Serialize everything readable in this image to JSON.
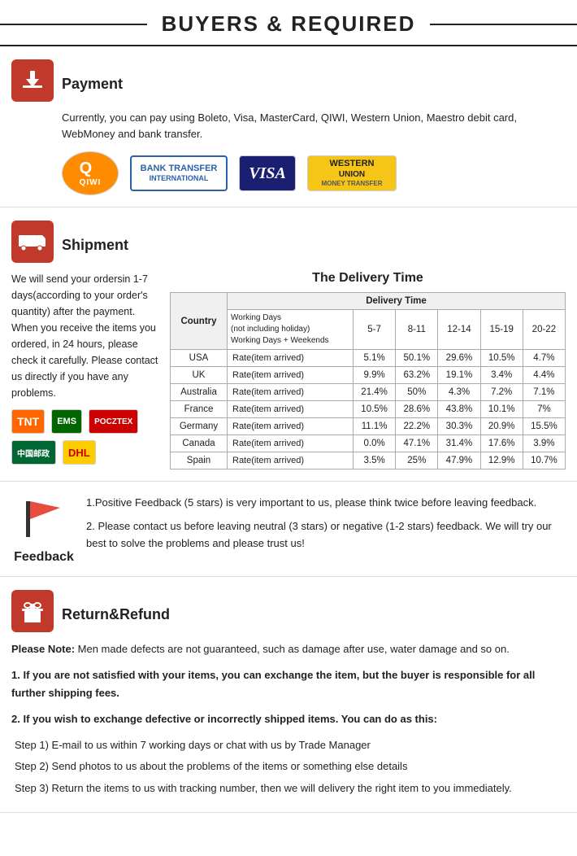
{
  "header": {
    "title": "BUYERS & REQUIRED"
  },
  "payment": {
    "section_title": "Payment",
    "description": "Currently, you can pay using Boleto, Visa, MasterCard, QIWI, Western Union, Maestro  debit card, WebMoney and bank transfer.",
    "logos": [
      {
        "name": "QIWI",
        "type": "qiwi"
      },
      {
        "name": "BANK TRANSFER INTERNATIONAL",
        "type": "bank"
      },
      {
        "name": "VISA",
        "type": "visa"
      },
      {
        "name": "WESTERN UNION MONEY TRANSFER",
        "type": "wu"
      }
    ]
  },
  "shipment": {
    "section_title": "Shipment",
    "delivery_title": "The Delivery Time",
    "text": "We will send your ordersin 1-7 days(according to your order's quantity) after the payment. When you receive the items you ordered, in 24  hours, please check it carefully. Please  contact us directly if you have any problems.",
    "table": {
      "headers": [
        "Country",
        "Delivery Time"
      ],
      "day_ranges": [
        "5-7",
        "8-11",
        "12-14",
        "15-19",
        "20-22"
      ],
      "working_days_label": "Working Days",
      "not_holiday_label": "(not including holiday)",
      "weekends_label": "Working Days + Weekends",
      "rows": [
        {
          "country": "USA",
          "rate": "Rate(item arrived)",
          "vals": [
            "5.1%",
            "50.1%",
            "29.6%",
            "10.5%",
            "4.7%"
          ]
        },
        {
          "country": "UK",
          "rate": "Rate(item arrived)",
          "vals": [
            "9.9%",
            "63.2%",
            "19.1%",
            "3.4%",
            "4.4%"
          ]
        },
        {
          "country": "Australia",
          "rate": "Rate(item arrived)",
          "vals": [
            "21.4%",
            "50%",
            "4.3%",
            "7.2%",
            "7.1%"
          ]
        },
        {
          "country": "France",
          "rate": "Rate(item arrived)",
          "vals": [
            "10.5%",
            "28.6%",
            "43.8%",
            "10.1%",
            "7%"
          ]
        },
        {
          "country": "Germany",
          "rate": "Rate(item arrived)",
          "vals": [
            "11.1%",
            "22.2%",
            "30.3%",
            "20.9%",
            "15.5%"
          ]
        },
        {
          "country": "Canada",
          "rate": "Rate(item arrived)",
          "vals": [
            "0.0%",
            "47.1%",
            "31.4%",
            "17.6%",
            "3.9%"
          ]
        },
        {
          "country": "Spain",
          "rate": "Rate(item arrived)",
          "vals": [
            "3.5%",
            "25%",
            "47.9%",
            "12.9%",
            "10.7%"
          ]
        }
      ]
    },
    "logos": [
      {
        "name": "TNT",
        "type": "tnt"
      },
      {
        "name": "EMS",
        "type": "ems"
      },
      {
        "name": "POCZTEX",
        "type": "pocztex"
      },
      {
        "name": "CHINA POST",
        "type": "chinapost"
      },
      {
        "name": "DHL",
        "type": "dhl"
      }
    ]
  },
  "feedback": {
    "section_title": "Feedback",
    "point1": "1.Positive Feedback (5 stars) is very important to us, please think twice before leaving feedback.",
    "point2": "2. Please contact us before leaving neutral (3 stars) or negative  (1-2 stars) feedback. We will try our best to solve the problems and please trust us!"
  },
  "return_refund": {
    "section_title": "Return&Refund",
    "note_label": "Please Note:",
    "note_text": " Men made defects are not guaranteed, such as damage after use, water damage and so on.",
    "point1": "1. If you are not satisfied with your items, you can exchange the item, but the buyer is responsible for all further shipping fees.",
    "point2_label": "2. If you wish to exchange defective or incorrectly shipped items. You can do as this:",
    "steps": [
      "Step 1) E-mail to us within 7 working days or chat with us by Trade Manager",
      "Step 2) Send photos to us about the problems of the items or something else details",
      "Step 3) Return the items to us with tracking number, then we will delivery the right item to you immediately."
    ]
  }
}
